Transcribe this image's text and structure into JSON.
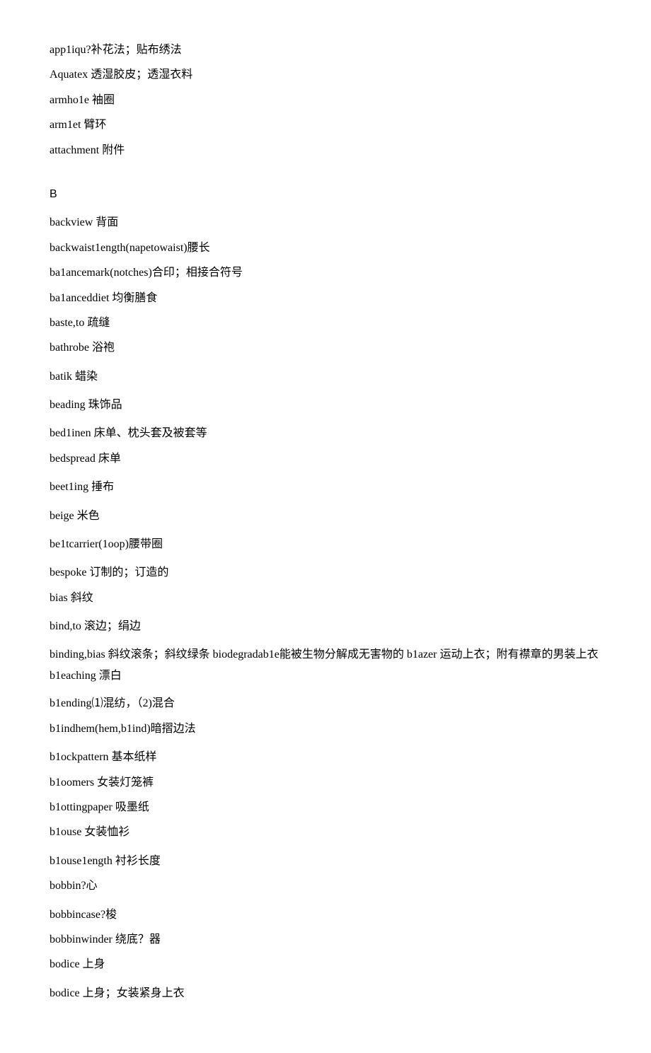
{
  "entries": [
    {
      "text": "app1iqu?补花法；贴布绣法",
      "class": "entry"
    },
    {
      "text": "Aquatex 透湿胶皮；透湿衣料",
      "class": "entry"
    },
    {
      "text": "armho1e 袖圈",
      "class": "entry"
    },
    {
      "text": "arm1et 臂环",
      "class": "entry"
    },
    {
      "text": "attachment 附件",
      "class": "entry"
    },
    {
      "text": "B",
      "class": "section-header"
    },
    {
      "text": "backview 背面",
      "class": "entry"
    },
    {
      "text": "backwaist1ength(napetowaist)腰长",
      "class": "entry"
    },
    {
      "text": "ba1ancemark(notches)合印；相接合符号",
      "class": "entry"
    },
    {
      "text": "ba1anceddiet 均衡膳食",
      "class": "entry"
    },
    {
      "text": "baste,to 疏缝",
      "class": "entry"
    },
    {
      "text": "bathrobe 浴袍",
      "class": "entry"
    },
    {
      "text": "batik 蜡染",
      "class": "entry group-gap"
    },
    {
      "text": "beading 珠饰品",
      "class": "entry group-gap"
    },
    {
      "text": "bed1inen 床单、枕头套及被套等",
      "class": "entry group-gap"
    },
    {
      "text": "bedspread 床单",
      "class": "entry"
    },
    {
      "text": "beet1ing 捶布",
      "class": "entry group-gap"
    },
    {
      "text": "beige 米色",
      "class": "entry group-gap"
    },
    {
      "text": "be1tcarrier(1oop)腰带圈",
      "class": "entry group-gap"
    },
    {
      "text": "bespoke 订制的；订造的",
      "class": "entry group-gap"
    },
    {
      "text": "bias 斜纹",
      "class": "entry"
    },
    {
      "text": "bind,to 滚边；绢边",
      "class": "entry group-gap"
    },
    {
      "text": "binding,bias 斜纹滚条；斜纹绿条 biodegradab1e能被生物分解成无害物的 b1azer 运动上衣；附有襟章的男装上衣 b1eaching 漂白",
      "class": "entry multi-line"
    },
    {
      "text": "b1ending⑴混纺，（2)混合",
      "class": "entry"
    },
    {
      "text": "b1indhem(hem,b1ind)暗摺边法",
      "class": "entry"
    },
    {
      "text": "b1ockpattern 基本纸样",
      "class": "entry group-gap"
    },
    {
      "text": "b1oomers 女装灯笼裤",
      "class": "entry"
    },
    {
      "text": "b1ottingpaper 吸墨纸",
      "class": "entry"
    },
    {
      "text": "b1ouse 女装恤衫",
      "class": "entry"
    },
    {
      "text": "b1ouse1ength 衬衫长度",
      "class": "entry group-gap"
    },
    {
      "text": "bobbin?心",
      "class": "entry"
    },
    {
      "text": "bobbincase?梭",
      "class": "entry group-gap"
    },
    {
      "text": "bobbinwinder 绕底？器",
      "class": "entry"
    },
    {
      "text": "bodice 上身",
      "class": "entry"
    },
    {
      "text": "bodice 上身；女装紧身上衣",
      "class": "entry group-gap"
    }
  ]
}
